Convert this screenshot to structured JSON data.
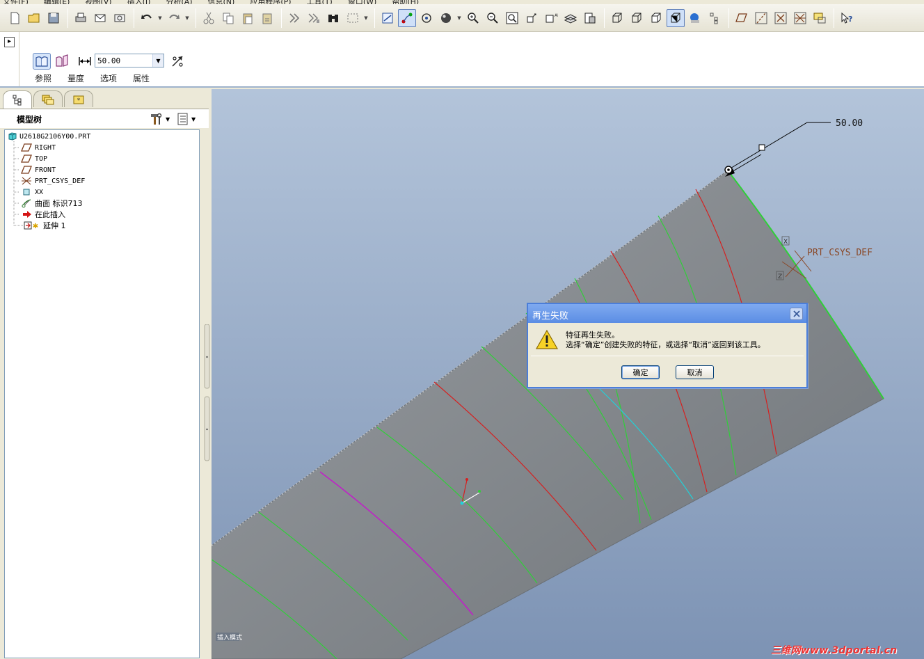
{
  "menubar": [
    "文件(F)",
    "编辑(E)",
    "视图(V)",
    "插入(I)",
    "分析(A)",
    "信息(N)",
    "应用程序(P)",
    "工具(T)",
    "窗口(W)",
    "帮助(H)"
  ],
  "toolbar": {
    "icons": [
      "new-file-icon",
      "open-file-icon",
      "save-icon",
      "print-icon",
      "email-icon",
      "email-link-icon",
      "undo-icon",
      "redo-icon",
      "cut-icon",
      "copy-icon",
      "paste-icon",
      "paste-special-icon",
      "regenerate-icon",
      "regenerate-manager-icon",
      "find-icon",
      "select-box-icon",
      "repaint-icon",
      "spin-center-icon",
      "orient-mode-icon",
      "appearance-sphere-icon",
      "zoom-in-icon",
      "zoom-out-icon",
      "refit-icon",
      "reorient-icon",
      "saved-views-icon",
      "layers-icon",
      "view-manager-icon",
      "wireframe-icon",
      "hidden-line-icon",
      "no-hidden-icon",
      "shaded-icon",
      "enhanced-realism-icon",
      "model-tree-toggle-icon",
      "datum-planes-icon",
      "datum-axes-icon",
      "datum-points-icon",
      "coordinate-systems-icon",
      "annotations-icon",
      "context-help-icon"
    ]
  },
  "dashboard": {
    "depth_value": "50.00",
    "tabs": [
      "参照",
      "量度",
      "选项",
      "属性"
    ]
  },
  "model_tree": {
    "title": "模型树",
    "items": [
      {
        "label": "U2618G2106Y00.PRT",
        "icon": "part-icon"
      },
      {
        "label": "RIGHT",
        "icon": "datum-plane-icon"
      },
      {
        "label": "TOP",
        "icon": "datum-plane-icon"
      },
      {
        "label": "FRONT",
        "icon": "datum-plane-icon"
      },
      {
        "label": "PRT_CSYS_DEF",
        "icon": "csys-icon"
      },
      {
        "label": "XX",
        "icon": "datum-point-icon"
      },
      {
        "label": "曲面 标识713",
        "icon": "surface-icon"
      },
      {
        "label": "在此插入",
        "icon": "insert-here-arrow-icon"
      },
      {
        "label": "延伸 1",
        "icon": "extend-feature-icon"
      }
    ]
  },
  "viewport": {
    "dimension_label": "50.00",
    "csys_label": "PRT_CSYS_DEF",
    "csys_x": "X",
    "csys_z": "Z",
    "mode_label": "插入模式",
    "watermark": "三维网www.3dportal.cn"
  },
  "dialog": {
    "title": "再生失败",
    "message_line1": "特征再生失败。",
    "message_line2": "选择“确定”创建失败的特征，或选择“取消”返回到该工具。",
    "ok_label": "确定",
    "cancel_label": "取消"
  },
  "colors": {
    "viewport_top": "#a9bbd4",
    "viewport_bottom": "#7f95b6",
    "surface": "#8c9196",
    "curve_green": "#2fcf38",
    "curve_red": "#d62020",
    "curve_cyan": "#22d0d8",
    "curve_magenta": "#c020c8",
    "dialog_title": "#5b8de4"
  }
}
